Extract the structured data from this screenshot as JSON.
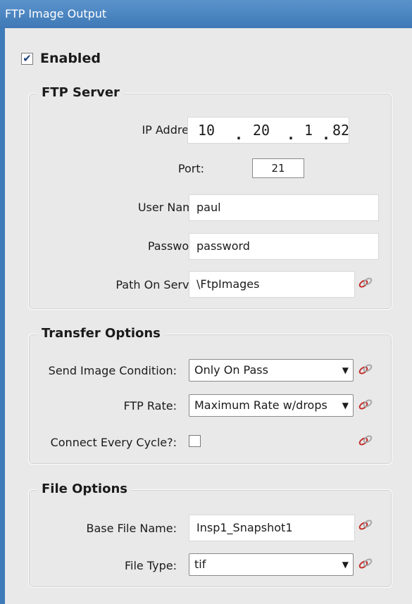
{
  "window": {
    "title": "FTP Image Output"
  },
  "enabled": {
    "label": "Enabled",
    "checked": true,
    "check_glyph": "✔"
  },
  "ftp_server": {
    "legend": "FTP Server",
    "ip_label": "IP Address:",
    "ip_octets": [
      "10",
      "20",
      "1",
      "82"
    ],
    "ip_sep": ".",
    "port_label": "Port:",
    "port_value": "21",
    "username_label": "User Name:",
    "username_value": "paul",
    "password_label": "Password:",
    "password_value": "password",
    "path_label": "Path On Server:",
    "path_value": "\\FtpImages"
  },
  "transfer_options": {
    "legend": "Transfer Options",
    "send_condition_label": "Send Image Condition:",
    "send_condition_value": "Only On Pass",
    "ftp_rate_label": "FTP Rate:",
    "ftp_rate_value": "Maximum Rate w/drops",
    "connect_every_cycle_label": "Connect Every Cycle?:",
    "connect_every_cycle_checked": false
  },
  "file_options": {
    "legend": "File Options",
    "base_name_label": "Base File Name:",
    "base_name_value": "Insp1_Snapshot1",
    "file_type_label": "File Type:",
    "file_type_value": "tif"
  },
  "icons": {
    "link": "link-icon",
    "dropdown": "▼"
  },
  "colors": {
    "title_bar": "#4a86c3",
    "link_icon": "#c0302d"
  }
}
